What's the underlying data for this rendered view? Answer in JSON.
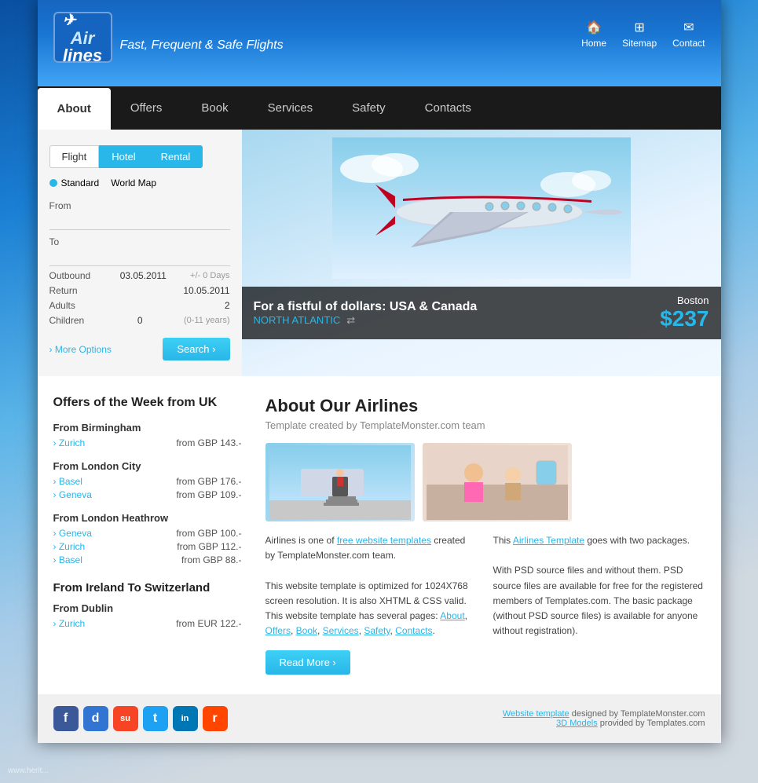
{
  "site": {
    "logo_line1": "Air",
    "logo_line2": "lines",
    "tagline": "Fast, Frequent & Safe Flights"
  },
  "header_nav": {
    "items": [
      {
        "label": "Home",
        "icon": "🏠"
      },
      {
        "label": "Sitemap",
        "icon": "🗺"
      },
      {
        "label": "Contact",
        "icon": "✉"
      }
    ]
  },
  "main_nav": {
    "items": [
      {
        "label": "About",
        "active": true
      },
      {
        "label": "Offers"
      },
      {
        "label": "Book"
      },
      {
        "label": "Services"
      },
      {
        "label": "Safety"
      },
      {
        "label": "Contacts"
      }
    ]
  },
  "search": {
    "tabs": [
      "Flight",
      "Hotel",
      "Rental"
    ],
    "active_tab": "Hotel",
    "map_options": [
      "Standard",
      "World Map"
    ],
    "from_label": "From",
    "to_label": "To",
    "outbound_label": "Outbound",
    "outbound_value": "03.05.2011",
    "outbound_hint": "+/- 0 Days",
    "return_label": "Return",
    "return_value": "10.05.2011",
    "adults_label": "Adults",
    "adults_value": "2",
    "children_label": "Children",
    "children_value": "0",
    "children_hint": "(0-11 years)",
    "more_options": "More Options",
    "search_button": "Search"
  },
  "hero": {
    "title": "For a fistful of dollars: USA & Canada",
    "subtitle": "NORTH ATLANTIC",
    "city": "Boston",
    "price": "$237"
  },
  "offers": {
    "section_title": "Offers of the Week from UK",
    "groups": [
      {
        "title": "From Birmingham",
        "items": [
          {
            "destination": "Zurich",
            "price": "from GBP 143.-"
          }
        ]
      },
      {
        "title": "From London City",
        "items": [
          {
            "destination": "Basel",
            "price": "from GBP 176.-"
          },
          {
            "destination": "Geneva",
            "price": "from GBP 109.-"
          }
        ]
      },
      {
        "title": "From London Heathrow",
        "items": [
          {
            "destination": "Geneva",
            "price": "from GBP 100.-"
          },
          {
            "destination": "Zurich",
            "price": "from GBP 112.-"
          },
          {
            "destination": "Basel",
            "price": "from GBP 88.-"
          }
        ]
      }
    ],
    "section2_title": "From Ireland To Switzerland",
    "groups2": [
      {
        "title": "From Dublin",
        "items": [
          {
            "destination": "Zurich",
            "price": "from EUR 122.-"
          }
        ]
      }
    ]
  },
  "about": {
    "title": "About Our Airlines",
    "subtitle": "Template created by TemplateMonster.com team",
    "col1_text1": "Airlines is one of ",
    "col1_link1": "free website templates",
    "col1_text2": " created by TemplateMonster.com team.",
    "col1_text3": "This website template is optimized for 1024X768 screen resolution. It is also XHTML & CSS valid. This website template has several pages: ",
    "col1_links": "About, Offers, Book, Services, Safety, Contacts",
    "col2_text1": "This ",
    "col2_link1": "Airlines Template",
    "col2_text2": " goes with two packages.",
    "col2_text3": "With PSD source files and without them. PSD source files are available for free for the registered members of Templates.com. The basic package (without PSD source files) is available for anyone without registration).",
    "read_more": "Read More"
  },
  "footer": {
    "social": [
      {
        "name": "Facebook",
        "class": "social-fb",
        "symbol": "f"
      },
      {
        "name": "Delicious",
        "class": "social-delicious",
        "symbol": "d"
      },
      {
        "name": "StumbleUpon",
        "class": "social-stumble",
        "symbol": "su"
      },
      {
        "name": "Twitter",
        "class": "social-twitter",
        "symbol": "t"
      },
      {
        "name": "LinkedIn",
        "class": "social-linkedin",
        "symbol": "in"
      },
      {
        "name": "Reddit",
        "class": "social-reddit",
        "symbol": "r"
      }
    ],
    "credit1": "Website template",
    "credit1_text": " designed by TemplateMonster.com",
    "credit2": "3D Models",
    "credit2_text": " provided by Templates.com"
  },
  "watermark": "www.herit..."
}
